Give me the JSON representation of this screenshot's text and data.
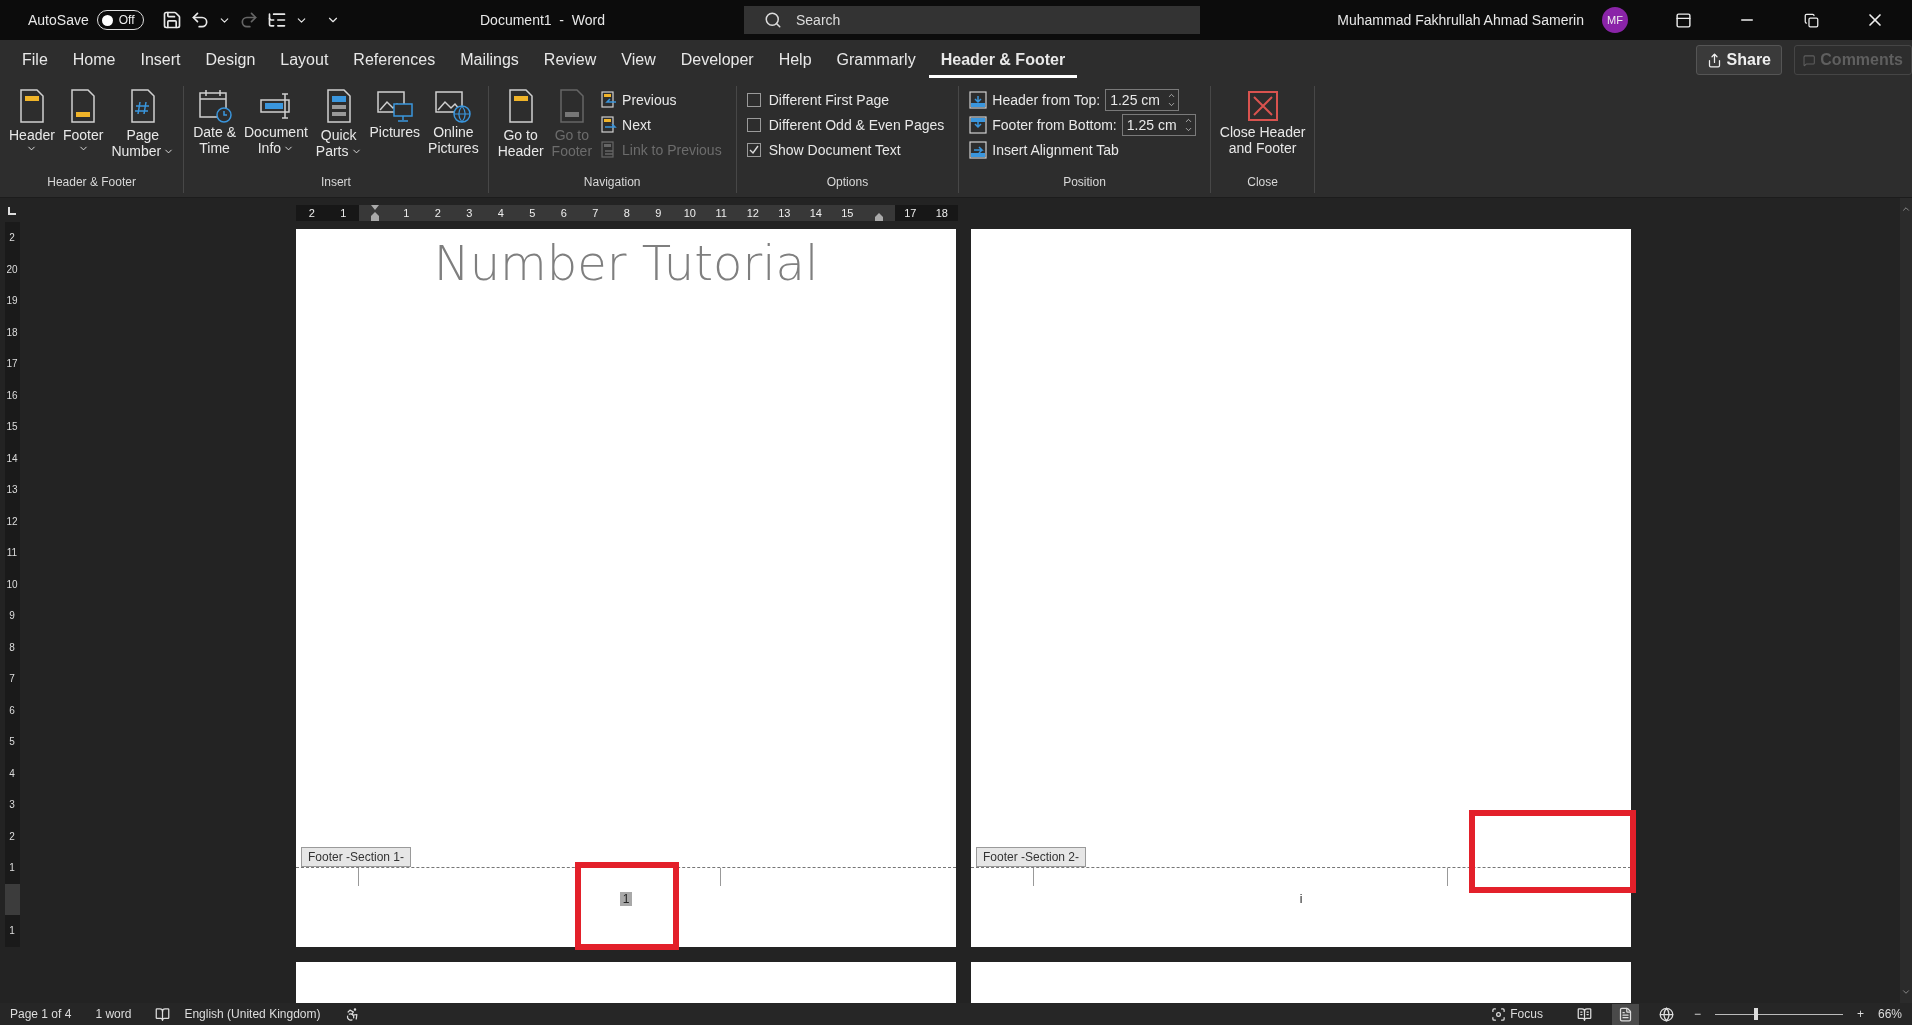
{
  "title_bar": {
    "autosave_label": "AutoSave",
    "autosave_toggle": {
      "label": "Off",
      "on": false
    },
    "quick_access": [
      {
        "disabled": false
      },
      {
        "disabled": false
      },
      {
        "disabled": true
      },
      {
        "disabled": false
      }
    ],
    "title": "Document1  -  Word",
    "search": {
      "placeholder": "Search"
    },
    "user_name": "Muhammad Fakhrullah Ahmad Samerin",
    "avatar": "MF"
  },
  "menu_tabs": [
    {
      "label": "File",
      "selected": false
    },
    {
      "label": "Home",
      "selected": false
    },
    {
      "label": "Insert",
      "selected": false
    },
    {
      "label": "Design",
      "selected": false
    },
    {
      "label": "Layout",
      "selected": false
    },
    {
      "label": "References",
      "selected": false
    },
    {
      "label": "Mailings",
      "selected": false
    },
    {
      "label": "Review",
      "selected": false
    },
    {
      "label": "View",
      "selected": false
    },
    {
      "label": "Developer",
      "selected": false
    },
    {
      "label": "Help",
      "selected": false
    },
    {
      "label": "Grammarly",
      "selected": false
    },
    {
      "label": "Header & Footer",
      "selected": true
    }
  ],
  "share_button": {
    "label": "Share"
  },
  "comments_button": {
    "label": "Comments",
    "disabled": true
  },
  "ribbon_groups": [
    {
      "label": "Header & Footer",
      "items": [
        {
          "kind": "large",
          "lines": [
            "Header"
          ],
          "dropdown": true,
          "disabled": false
        },
        {
          "kind": "large",
          "lines": [
            "Footer"
          ],
          "dropdown": true,
          "disabled": false
        },
        {
          "kind": "large",
          "lines": [
            "Page",
            "Number"
          ],
          "dropdown": true,
          "disabled": false
        }
      ]
    },
    {
      "label": "Insert",
      "items": [
        {
          "kind": "large",
          "lines": [
            "Date &",
            "Time"
          ],
          "dropdown": false,
          "disabled": false
        },
        {
          "kind": "large",
          "lines": [
            "Document",
            "Info"
          ],
          "dropdown": true,
          "disabled": false
        },
        {
          "kind": "large",
          "lines": [
            "Quick",
            "Parts"
          ],
          "dropdown": true,
          "disabled": false
        },
        {
          "kind": "large",
          "lines": [
            "Pictures"
          ],
          "dropdown": false,
          "disabled": false
        },
        {
          "kind": "large",
          "lines": [
            "Online",
            "Pictures"
          ],
          "dropdown": false,
          "disabled": false
        }
      ]
    },
    {
      "label": "Navigation",
      "items": [
        {
          "kind": "large",
          "lines": [
            "Go to",
            "Header"
          ],
          "dropdown": false,
          "disabled": false
        },
        {
          "kind": "large",
          "lines": [
            "Go to",
            "Footer"
          ],
          "dropdown": false,
          "disabled": true
        },
        {
          "kind": "stack",
          "items": [
            {
              "kind": "small",
              "label": "Previous",
              "disabled": false
            },
            {
              "kind": "small",
              "label": "Next",
              "disabled": false
            },
            {
              "kind": "small",
              "label": "Link to Previous",
              "disabled": true
            }
          ]
        }
      ]
    },
    {
      "label": "Options",
      "items": [
        {
          "kind": "stack",
          "items": [
            {
              "kind": "check",
              "label": "Different First Page",
              "checked": false
            },
            {
              "kind": "check",
              "label": "Different Odd & Even Pages",
              "checked": false
            },
            {
              "kind": "check",
              "label": "Show Document Text",
              "checked": true
            }
          ]
        }
      ]
    },
    {
      "label": "Position",
      "items": [
        {
          "kind": "stack",
          "items": [
            {
              "kind": "spinner",
              "label": "Header from Top:",
              "value": "1.25 cm"
            },
            {
              "kind": "spinner",
              "label": "Footer from Bottom:",
              "value": "1.25 cm"
            },
            {
              "kind": "small",
              "label": "Insert Alignment Tab",
              "disabled": false
            }
          ]
        }
      ]
    },
    {
      "label": "Close",
      "items": [
        {
          "kind": "large",
          "lines": [
            "Close Header",
            "and Footer"
          ],
          "dropdown": false,
          "disabled": false
        }
      ]
    }
  ],
  "ruler": {
    "left_numbers": [
      "2",
      "1"
    ],
    "numbers": [
      "1",
      "2",
      "3",
      "4",
      "5",
      "6",
      "7",
      "8",
      "9",
      "10",
      "11",
      "12",
      "13",
      "14",
      "15"
    ],
    "right_numbers": [
      "17",
      "18"
    ]
  },
  "vertical_ruler": {
    "numbers": [
      "2",
      "20",
      "19",
      "18",
      "17",
      "16",
      "15",
      "14",
      "13",
      "12",
      "11",
      "10",
      "9",
      "8",
      "7",
      "6",
      "5",
      "4",
      "3",
      "2",
      "1"
    ],
    "footer_numbers": [
      "1"
    ]
  },
  "pages": [
    {
      "title": "Number Tutorial",
      "footer_tag": "Footer -Section 1-",
      "footer_text": "1",
      "footer_text_selected": true
    },
    {
      "footer_tag": "Footer -Section 2-",
      "footer_text": "i",
      "footer_text_selected": false
    }
  ],
  "status_bar": {
    "page": "Page 1 of 4",
    "words": "1 word",
    "language": "English (United Kingdom)",
    "focus": "Focus",
    "views": [
      {
        "selected": false
      },
      {
        "selected": true
      },
      {
        "selected": false
      }
    ],
    "zoom_minus": "−",
    "zoom_plus": "+",
    "zoom": {
      "level": 0.32
    },
    "zoom_percent": "66%"
  }
}
